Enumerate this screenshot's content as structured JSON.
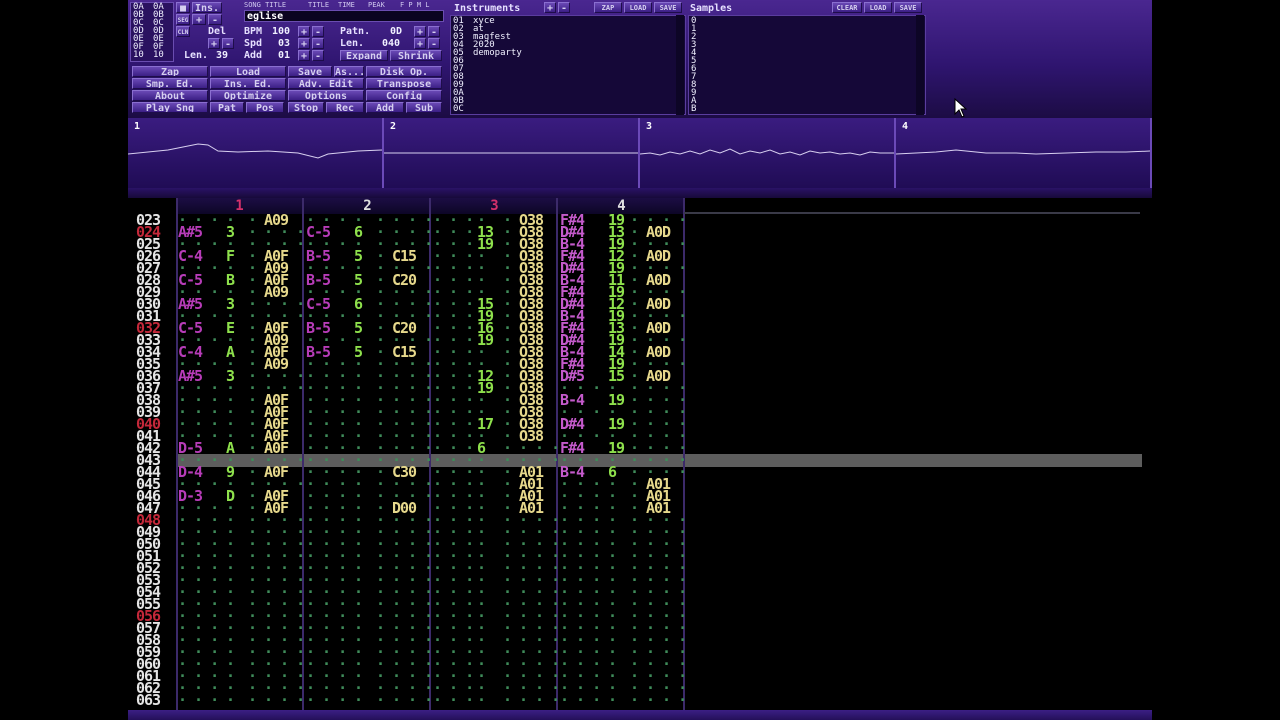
{
  "top": {
    "positions": [
      "0A",
      "0B",
      "0C",
      "0D",
      "0E",
      "0F",
      "10"
    ],
    "pos_right": [
      "0A",
      "0B",
      "0C",
      "0D",
      "0E",
      "0F",
      "10"
    ],
    "ins_label": "Ins.",
    "seg_label": "SEG",
    "cln_label": "CLN",
    "tab_song_title": "SONG TITLE",
    "tab_title": "TITLE",
    "tab_time": "TIME",
    "tab_peak": "PEAK",
    "tab_flags": "F P M L",
    "song_title": "eglise",
    "del_label": "Del",
    "len_label": "Len.",
    "len_value": "39",
    "bpm_label": "BPM",
    "bpm_value": "100",
    "spd_label": "Spd",
    "spd_value": "03",
    "add_label": "Add",
    "add_value": "01",
    "patn_label": "Patn.",
    "patn_value": "0D",
    "plen_label": "Len.",
    "plen_value": "040",
    "expand_label": "Expand",
    "shrink_label": "Shrink",
    "plus": "+",
    "minus": "-",
    "buttons": [
      [
        "Zap",
        "Load",
        "Save",
        "As...",
        "Disk Op."
      ],
      [
        "Smp. Ed.",
        "Ins. Ed.",
        "Adv. Edit",
        "Transpose"
      ],
      [
        "About",
        "Optimize",
        "Options",
        "Config"
      ],
      [
        "Play Sng",
        "Pat",
        "Pos",
        "Stop",
        "Rec",
        "Add",
        "Sub"
      ]
    ]
  },
  "instruments": {
    "title": "Instruments",
    "zap": "ZAP",
    "load": "LOAD",
    "save": "SAVE",
    "items": [
      {
        "num": "01",
        "name": "xyce"
      },
      {
        "num": "02",
        "name": "at"
      },
      {
        "num": "03",
        "name": "magfest"
      },
      {
        "num": "04",
        "name": "2020"
      },
      {
        "num": "05",
        "name": "demoparty"
      },
      {
        "num": "06",
        "name": ""
      },
      {
        "num": "07",
        "name": ""
      },
      {
        "num": "08",
        "name": ""
      },
      {
        "num": "09",
        "name": ""
      },
      {
        "num": "0A",
        "name": ""
      },
      {
        "num": "0B",
        "name": ""
      },
      {
        "num": "0C",
        "name": ""
      }
    ]
  },
  "samples": {
    "title": "Samples",
    "clear": "CLEAR",
    "load": "LOAD",
    "save": "SAVE",
    "nums": [
      "0",
      "1",
      "2",
      "3",
      "4",
      "5",
      "6",
      "7",
      "8",
      "9",
      "A",
      "B"
    ]
  },
  "scopes": [
    "1",
    "2",
    "3",
    "4"
  ],
  "channels": [
    {
      "label": "1",
      "color": "#d4306a"
    },
    {
      "label": "2",
      "color": "#e0e0e0"
    },
    {
      "label": "3",
      "color": "#d4306a"
    },
    {
      "label": "4",
      "color": "#e0e0e0"
    }
  ],
  "rows": [
    {
      "n": "023",
      "red": false,
      "c": [
        [
          "",
          "",
          "",
          "A09"
        ],
        [
          "",
          "",
          "",
          ""
        ],
        [
          "",
          "",
          "",
          "O38"
        ],
        [
          "F#4",
          "19",
          "",
          ""
        ]
      ]
    },
    {
      "n": "024",
      "red": true,
      "c": [
        [
          "A#5",
          "3",
          "",
          ""
        ],
        [
          "C-5",
          "6",
          "",
          ""
        ],
        [
          "",
          "13",
          "",
          "O38"
        ],
        [
          "D#4",
          "13",
          "",
          "A0D"
        ]
      ]
    },
    {
      "n": "025",
      "red": false,
      "c": [
        [
          "",
          "",
          "",
          ""
        ],
        [
          "",
          "",
          "",
          ""
        ],
        [
          "",
          "19",
          "",
          "O38"
        ],
        [
          "B-4",
          "19",
          "",
          ""
        ]
      ]
    },
    {
      "n": "026",
      "red": false,
      "c": [
        [
          "C-4",
          "F",
          "",
          "A0F"
        ],
        [
          "B-5",
          "5",
          "",
          "C15"
        ],
        [
          "",
          "",
          "",
          "O38"
        ],
        [
          "F#4",
          "12",
          "",
          "A0D"
        ]
      ]
    },
    {
      "n": "027",
      "red": false,
      "c": [
        [
          "",
          "",
          "",
          "A09"
        ],
        [
          "",
          "",
          "",
          ""
        ],
        [
          "",
          "",
          "",
          "O38"
        ],
        [
          "D#4",
          "19",
          "",
          ""
        ]
      ]
    },
    {
      "n": "028",
      "red": false,
      "c": [
        [
          "C-5",
          "B",
          "",
          "A0F"
        ],
        [
          "B-5",
          "5",
          "",
          "C20"
        ],
        [
          "",
          "",
          "",
          "O38"
        ],
        [
          "B-4",
          "11",
          "",
          "A0D"
        ]
      ]
    },
    {
      "n": "029",
      "red": false,
      "c": [
        [
          "",
          "",
          "",
          "A09"
        ],
        [
          "",
          "",
          "",
          ""
        ],
        [
          "",
          "",
          "",
          "O38"
        ],
        [
          "F#4",
          "19",
          "",
          ""
        ]
      ]
    },
    {
      "n": "030",
      "red": false,
      "c": [
        [
          "A#5",
          "3",
          "",
          ""
        ],
        [
          "C-5",
          "6",
          "",
          ""
        ],
        [
          "",
          "15",
          "",
          "O38"
        ],
        [
          "D#4",
          "12",
          "",
          "A0D"
        ]
      ]
    },
    {
      "n": "031",
      "red": false,
      "c": [
        [
          "",
          "",
          "",
          ""
        ],
        [
          "",
          "",
          "",
          ""
        ],
        [
          "",
          "19",
          "",
          "O38"
        ],
        [
          "B-4",
          "19",
          "",
          ""
        ]
      ]
    },
    {
      "n": "032",
      "red": true,
      "c": [
        [
          "C-5",
          "E",
          "",
          "A0F"
        ],
        [
          "B-5",
          "5",
          "",
          "C20"
        ],
        [
          "",
          "16",
          "",
          "O38"
        ],
        [
          "F#4",
          "13",
          "",
          "A0D"
        ]
      ]
    },
    {
      "n": "033",
      "red": false,
      "c": [
        [
          "",
          "",
          "",
          "A09"
        ],
        [
          "",
          "",
          "",
          ""
        ],
        [
          "",
          "19",
          "",
          "O38"
        ],
        [
          "D#4",
          "19",
          "",
          ""
        ]
      ]
    },
    {
      "n": "034",
      "red": false,
      "c": [
        [
          "C-4",
          "A",
          "",
          "A0F"
        ],
        [
          "B-5",
          "5",
          "",
          "C15"
        ],
        [
          "",
          "",
          "",
          "O38"
        ],
        [
          "B-4",
          "14",
          "",
          "A0D"
        ]
      ]
    },
    {
      "n": "035",
      "red": false,
      "c": [
        [
          "",
          "",
          "",
          "A09"
        ],
        [
          "",
          "",
          "",
          ""
        ],
        [
          "",
          "",
          "",
          "O38"
        ],
        [
          "F#4",
          "19",
          "",
          ""
        ]
      ]
    },
    {
      "n": "036",
      "red": false,
      "c": [
        [
          "A#5",
          "3",
          "",
          ""
        ],
        [
          "",
          "",
          "",
          ""
        ],
        [
          "",
          "12",
          "",
          "O38"
        ],
        [
          "D#5",
          "15",
          "",
          "A0D"
        ]
      ]
    },
    {
      "n": "037",
      "red": false,
      "c": [
        [
          "",
          "",
          "",
          ""
        ],
        [
          "",
          "",
          "",
          ""
        ],
        [
          "",
          "19",
          "",
          "O38"
        ],
        [
          "",
          "",
          "",
          ""
        ]
      ]
    },
    {
      "n": "038",
      "red": false,
      "c": [
        [
          "",
          "",
          "",
          "A0F"
        ],
        [
          "",
          "",
          "",
          ""
        ],
        [
          "",
          "",
          "",
          "O38"
        ],
        [
          "B-4",
          "19",
          "",
          ""
        ]
      ]
    },
    {
      "n": "039",
      "red": false,
      "c": [
        [
          "",
          "",
          "",
          "A0F"
        ],
        [
          "",
          "",
          "",
          ""
        ],
        [
          "",
          "",
          "",
          "O38"
        ],
        [
          "",
          "",
          "",
          ""
        ]
      ]
    },
    {
      "n": "040",
      "red": true,
      "c": [
        [
          "",
          "",
          "",
          "A0F"
        ],
        [
          "",
          "",
          "",
          ""
        ],
        [
          "",
          "17",
          "",
          "O38"
        ],
        [
          "D#4",
          "19",
          "",
          ""
        ]
      ]
    },
    {
      "n": "041",
      "red": false,
      "c": [
        [
          "",
          "",
          "",
          "A0F"
        ],
        [
          "",
          "",
          "",
          ""
        ],
        [
          "",
          "",
          "",
          "O38"
        ],
        [
          "",
          "",
          "",
          ""
        ]
      ]
    },
    {
      "n": "042",
      "red": false,
      "c": [
        [
          "D-5",
          "A",
          "",
          "A0F"
        ],
        [
          "",
          "",
          "",
          ""
        ],
        [
          "",
          "6",
          "",
          ""
        ],
        [
          "F#4",
          "19",
          "",
          ""
        ]
      ]
    },
    {
      "n": "043",
      "red": false,
      "c": [
        [
          "",
          "",
          "",
          ""
        ],
        [
          "",
          "",
          "",
          ""
        ],
        [
          "",
          "",
          "",
          ""
        ],
        [
          "",
          "",
          "",
          ""
        ]
      ]
    },
    {
      "n": "044",
      "red": false,
      "c": [
        [
          "D-4",
          "9",
          "",
          "A0F"
        ],
        [
          "",
          "",
          "",
          "C30"
        ],
        [
          "",
          "",
          "",
          "A01"
        ],
        [
          "B-4",
          "6",
          "",
          ""
        ]
      ]
    },
    {
      "n": "045",
      "red": false,
      "c": [
        [
          "",
          "",
          "",
          ""
        ],
        [
          "",
          "",
          "",
          ""
        ],
        [
          "",
          "",
          "",
          "A01"
        ],
        [
          "",
          "",
          "",
          "A01"
        ]
      ]
    },
    {
      "n": "046",
      "red": false,
      "c": [
        [
          "D-3",
          "D",
          "",
          "A0F"
        ],
        [
          "",
          "",
          "",
          ""
        ],
        [
          "",
          "",
          "",
          "A01"
        ],
        [
          "",
          "",
          "",
          "A01"
        ]
      ]
    },
    {
      "n": "047",
      "red": false,
      "c": [
        [
          "",
          "",
          "",
          "A0F"
        ],
        [
          "",
          "",
          "",
          "D00"
        ],
        [
          "",
          "",
          "",
          "A01"
        ],
        [
          "",
          "",
          "",
          "A01"
        ]
      ]
    },
    {
      "n": "048",
      "red": true,
      "c": [
        [
          "",
          "",
          "",
          ""
        ],
        [
          "",
          "",
          "",
          ""
        ],
        [
          "",
          "",
          "",
          ""
        ],
        [
          "",
          "",
          "",
          ""
        ]
      ]
    },
    {
      "n": "049",
      "red": false,
      "c": [
        [
          "",
          "",
          "",
          ""
        ],
        [
          "",
          "",
          "",
          ""
        ],
        [
          "",
          "",
          "",
          ""
        ],
        [
          "",
          "",
          "",
          ""
        ]
      ]
    },
    {
      "n": "050",
      "red": false,
      "c": [
        [
          "",
          "",
          "",
          ""
        ],
        [
          "",
          "",
          "",
          ""
        ],
        [
          "",
          "",
          "",
          ""
        ],
        [
          "",
          "",
          "",
          ""
        ]
      ]
    },
    {
      "n": "051",
      "red": false,
      "c": [
        [
          "",
          "",
          "",
          ""
        ],
        [
          "",
          "",
          "",
          ""
        ],
        [
          "",
          "",
          "",
          ""
        ],
        [
          "",
          "",
          "",
          ""
        ]
      ]
    },
    {
      "n": "052",
      "red": false,
      "c": [
        [
          "",
          "",
          "",
          ""
        ],
        [
          "",
          "",
          "",
          ""
        ],
        [
          "",
          "",
          "",
          ""
        ],
        [
          "",
          "",
          "",
          ""
        ]
      ]
    },
    {
      "n": "053",
      "red": false,
      "c": [
        [
          "",
          "",
          "",
          ""
        ],
        [
          "",
          "",
          "",
          ""
        ],
        [
          "",
          "",
          "",
          ""
        ],
        [
          "",
          "",
          "",
          ""
        ]
      ]
    },
    {
      "n": "054",
      "red": false,
      "c": [
        [
          "",
          "",
          "",
          ""
        ],
        [
          "",
          "",
          "",
          ""
        ],
        [
          "",
          "",
          "",
          ""
        ],
        [
          "",
          "",
          "",
          ""
        ]
      ]
    },
    {
      "n": "055",
      "red": false,
      "c": [
        [
          "",
          "",
          "",
          ""
        ],
        [
          "",
          "",
          "",
          ""
        ],
        [
          "",
          "",
          "",
          ""
        ],
        [
          "",
          "",
          "",
          ""
        ]
      ]
    },
    {
      "n": "056",
      "red": true,
      "c": [
        [
          "",
          "",
          "",
          ""
        ],
        [
          "",
          "",
          "",
          ""
        ],
        [
          "",
          "",
          "",
          ""
        ],
        [
          "",
          "",
          "",
          ""
        ]
      ]
    },
    {
      "n": "057",
      "red": false,
      "c": [
        [
          "",
          "",
          "",
          ""
        ],
        [
          "",
          "",
          "",
          ""
        ],
        [
          "",
          "",
          "",
          ""
        ],
        [
          "",
          "",
          "",
          ""
        ]
      ]
    },
    {
      "n": "058",
      "red": false,
      "c": [
        [
          "",
          "",
          "",
          ""
        ],
        [
          "",
          "",
          "",
          ""
        ],
        [
          "",
          "",
          "",
          ""
        ],
        [
          "",
          "",
          "",
          ""
        ]
      ]
    },
    {
      "n": "059",
      "red": false,
      "c": [
        [
          "",
          "",
          "",
          ""
        ],
        [
          "",
          "",
          "",
          ""
        ],
        [
          "",
          "",
          "",
          ""
        ],
        [
          "",
          "",
          "",
          ""
        ]
      ]
    },
    {
      "n": "060",
      "red": false,
      "c": [
        [
          "",
          "",
          "",
          ""
        ],
        [
          "",
          "",
          "",
          ""
        ],
        [
          "",
          "",
          "",
          ""
        ],
        [
          "",
          "",
          "",
          ""
        ]
      ]
    },
    {
      "n": "061",
      "red": false,
      "c": [
        [
          "",
          "",
          "",
          ""
        ],
        [
          "",
          "",
          "",
          ""
        ],
        [
          "",
          "",
          "",
          ""
        ],
        [
          "",
          "",
          "",
          ""
        ]
      ]
    },
    {
      "n": "062",
      "red": false,
      "c": [
        [
          "",
          "",
          "",
          ""
        ],
        [
          "",
          "",
          "",
          ""
        ],
        [
          "",
          "",
          "",
          ""
        ],
        [
          "",
          "",
          "",
          ""
        ]
      ]
    },
    {
      "n": "063",
      "red": false,
      "c": [
        [
          "",
          "",
          "",
          ""
        ],
        [
          "",
          "",
          "",
          ""
        ],
        [
          "",
          "",
          "",
          ""
        ],
        [
          "",
          "",
          "",
          ""
        ]
      ]
    }
  ]
}
